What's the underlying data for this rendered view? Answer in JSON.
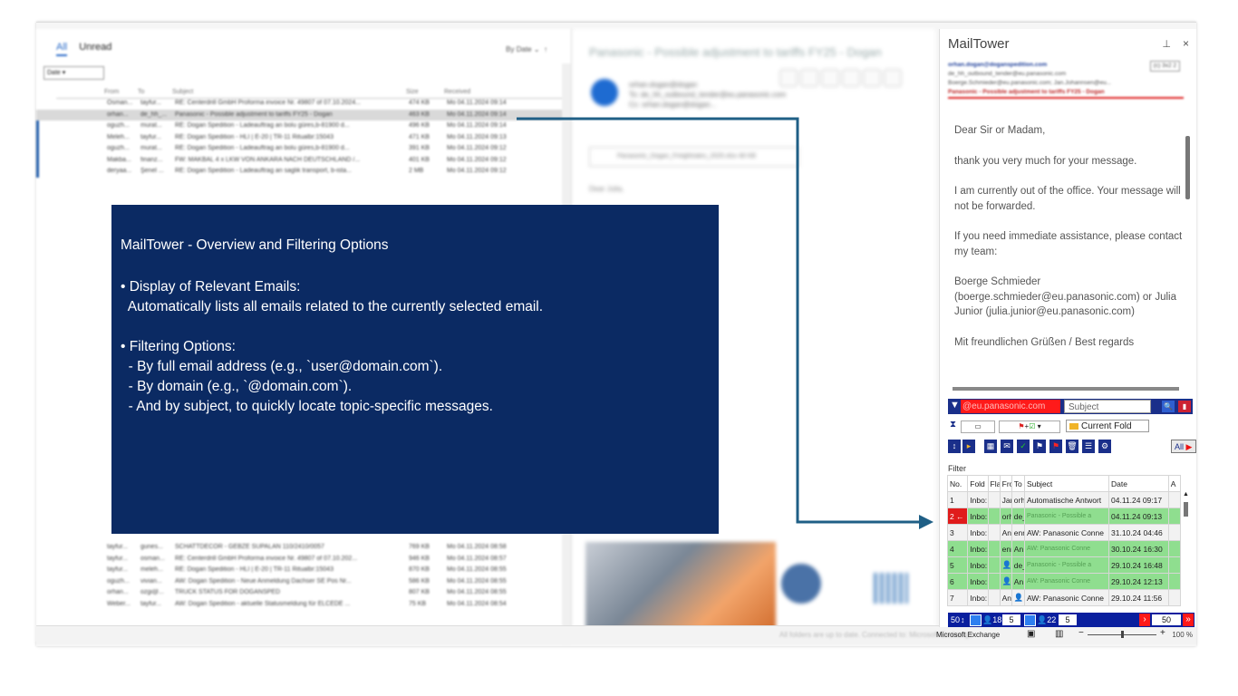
{
  "mail_list": {
    "tabs": [
      "All",
      "Unread"
    ],
    "sort": "By Date",
    "date_filter": "Date",
    "columns": [
      "From",
      "To",
      "Subject",
      "Size",
      "Received"
    ],
    "rows": [
      {
        "from": "Osman...",
        "to": "tayfur...",
        "subject": "RE: Centerdrill GmbH Proforma invoice Nr. 49807 of 07.10.2024...",
        "size": "474 KB",
        "date": "Mo 04.11.2024 09:14",
        "unread": false,
        "selected": false
      },
      {
        "from": "orhan...",
        "to": "de_hh_...",
        "subject": "Panasonic - Possible adjustment to tariffs FY25 - Dogan",
        "size": "463 KB",
        "date": "Mo 04.11.2024 09:14",
        "unread": false,
        "selected": true
      },
      {
        "from": "oguzh...",
        "to": "murat...",
        "subject": "RE: Dogan Spedition - Ladeauftrag an bolu güres,b-81900 d...",
        "size": "496 KB",
        "date": "Mo 04.11.2024 09:14",
        "unread": true,
        "selected": false
      },
      {
        "from": "Meleh...",
        "to": "tayfur...",
        "subject": "RE: Dogan Spedition - HLI | E-20 | TR-11 Ritualbr:15043",
        "size": "471 KB",
        "date": "Mo 04.11.2024 09:13",
        "unread": true,
        "selected": false
      },
      {
        "from": "oguzh...",
        "to": "murat...",
        "subject": "RE: Dogan Spedition - Ladeauftrag an bolu güres,b-81900 d...",
        "size": "391 KB",
        "date": "Mo 04.11.2024 09:12",
        "unread": true,
        "selected": false
      },
      {
        "from": "Makba...",
        "to": "finanz...",
        "subject": "FW: MAKBAL 4 x LKW VON ANKARA NACH DEUTSCHLAND /...",
        "size": "401 KB",
        "date": "Mo 04.11.2024 09:12",
        "unread": true,
        "selected": false
      },
      {
        "from": "deryaa...",
        "to": "Şenel ...",
        "subject": "RE: Dogan Spedition - Ladeauftrag an saglik transport, b-ista...",
        "size": "2 MB",
        "date": "Mo 04.11.2024 09:12",
        "unread": true,
        "selected": false
      }
    ],
    "rows_bottom": [
      {
        "from": "tayfur...",
        "to": "gunes...",
        "subject": "SCHATTDECOR - GEBZE SUPALAN 110/2410/0057",
        "size": "769 KB",
        "date": "Mo 04.11.2024 08:58"
      },
      {
        "from": "tayfur...",
        "to": "osman...",
        "subject": "RE: Centerdrill GmbH Proforma invoice Nr. 49807 of 07.10.202...",
        "size": "946 KB",
        "date": "Mo 04.11.2024 08:57"
      },
      {
        "from": "tayfur...",
        "to": "meleh...",
        "subject": "RE: Dogan Spedition - HLI | E-20 | TR-11 Ritualbr:15043",
        "size": "870 KB",
        "date": "Mo 04.11.2024 08:55"
      },
      {
        "from": "oguzh...",
        "to": "vivian...",
        "subject": "AW: Dogan Spedition - Neue Anmeldung Dachser SE Pos Nr...",
        "size": "586 KB",
        "date": "Mo 04.11.2024 08:55"
      },
      {
        "from": "orhan...",
        "to": "ozgi@...",
        "subject": "TRUCK STATUS FOR DOGANSPED",
        "size": "807 KB",
        "date": "Mo 04.11.2024 08:55"
      },
      {
        "from": "Weber...",
        "to": "tayfur...",
        "subject": "AW: Dogan Spedition - aktuelle Statusmeldung für ELCEDE ...",
        "size": "75 KB",
        "date": "Mo 04.11.2024 08:54"
      }
    ]
  },
  "reading_pane": {
    "subject": "Panasonic - Possible adjustment to tariffs FY25 - Dogan",
    "sender": "orhan.dogan@dogan",
    "to_line": "To: de_hh_outbound_tender@eu.panasonic.com",
    "cc_line": "Cc: orhan.dogan@dogan...",
    "attachment": "Panasonic_Dogan_Freightrates_2025.xlsx 46 KB",
    "greeting": "Dear Julia,"
  },
  "status_bar": {
    "connection": "Microsoft Exchange",
    "zoom": "100 %",
    "hint": "All folders are up to date.   Connected to: Microsoft Exchange"
  },
  "mailtower": {
    "title": "MailTower",
    "pin": "⊥",
    "close": "×",
    "header": {
      "from": "orhan.dogan@doganspedition.com",
      "to": "de_hh_outbound_tender@eu.panasonic.com",
      "cc": "Boerge.Schmieder@eu.panasonic.com; Jan.Johannsen@eu...",
      "subject": "Panasonic - Possible adjustment to tariffs FY25 - Dogan",
      "badge": "(c) 3x2 2"
    },
    "autoreply": [
      "Dear Sir or Madam,",
      "thank you very much for your message.",
      "I am currently out of the office. Your message will not be forwarded.",
      "If you need immediate assistance, please contact my team:",
      "Boerge Schmieder (boerge.schmieder@eu.panasonic.com) or Julia Junior (julia.junior@eu.panasonic.com)",
      "Mit freundlichen Grüßen / Best regards"
    ],
    "domain_filter": "@eu.panasonic.com",
    "subject_placeholder": "Subject",
    "folder_select": "Current Fold",
    "all_button": "All",
    "filter_label": "Filter",
    "grid_columns": [
      "No.",
      "Fold",
      "Fla",
      "Fro",
      "To",
      "Subject",
      "Date",
      "A"
    ],
    "grid_rows": [
      {
        "no": "1",
        "folder": "Inbo:",
        "from": "Jar",
        "to": "orh",
        "subject": "Automatische Antwort",
        "date": "04.11.24 09:17",
        "style": "w"
      },
      {
        "no": "2 ←",
        "folder": "Inbo:",
        "from": "orh",
        "to": "de_",
        "subject": "Panasonic - Possible a",
        "date": "04.11.24 09:13",
        "style": "g"
      },
      {
        "no": "3",
        "folder": "Inbo:",
        "from": "Anc",
        "to": "enr",
        "subject": "AW: Panasonic Conne",
        "date": "31.10.24 04:46",
        "style": "w"
      },
      {
        "no": "4",
        "folder": "Inbo:",
        "from": "enr",
        "to": "An",
        "subject": "AW: Panasonic Conne",
        "date": "30.10.24 16:30",
        "style": "g"
      },
      {
        "no": "5",
        "folder": "Inbo:",
        "from": "👤",
        "to": "de_",
        "subject": "Panasonic - Possible a",
        "date": "29.10.24 16:48",
        "style": "g"
      },
      {
        "no": "6",
        "folder": "Inbo:",
        "from": "👤",
        "to": "An",
        "subject": "AW: Panasonic Conne",
        "date": "29.10.24 12:13",
        "style": "g"
      },
      {
        "no": "7",
        "folder": "Inbo:",
        "from": "Anc",
        "to": "👤",
        "subject": "AW: Panasonic Conne",
        "date": "29.10.24 11:56",
        "style": "w"
      }
    ],
    "pager": {
      "total": "50",
      "received": "18",
      "received_box": "5",
      "sent": "22",
      "sent_box": "5",
      "page_size": "50"
    }
  },
  "overlay": {
    "title": "MailTower - Overview and Filtering Options",
    "lines": [
      "• Display of Relevant Emails:",
      "  Automatically lists all emails related to the currently selected email.",
      "",
      "• Filtering Options:",
      "  - By full email address (e.g., `user@domain.com`).",
      "  - By domain (e.g., `@domain.com`).",
      "  - And by subject, to quickly locate topic-specific messages."
    ]
  },
  "colors": {
    "overlay_bg": "#0b2a63",
    "connector": "#1f5f86",
    "domain_highlight": "#ff1a1a",
    "row_green": "#8fde8f",
    "toolbar_blue": "#1a2f8a"
  }
}
